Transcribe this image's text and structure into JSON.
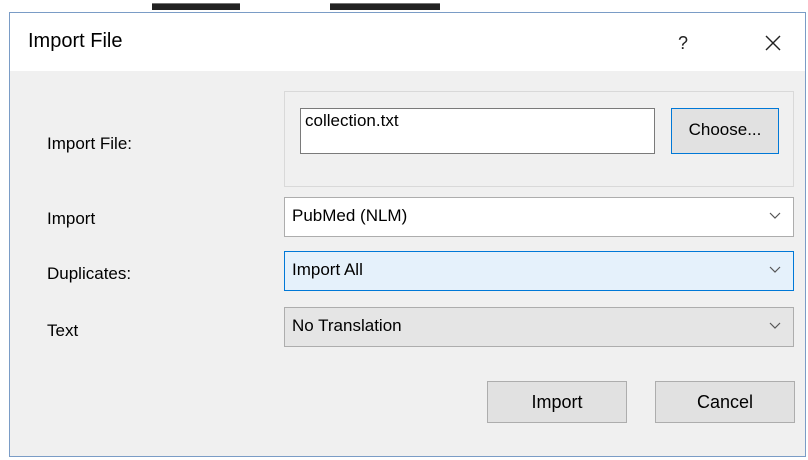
{
  "dialog": {
    "title": "Import File",
    "help_label": "?"
  },
  "fields": {
    "import_file": {
      "label": "Import File:",
      "value": "collection.txt",
      "choose_label": "Choose..."
    },
    "import_option": {
      "label": "Import",
      "selected": "PubMed (NLM)"
    },
    "duplicates": {
      "label": "Duplicates:",
      "selected": "Import All"
    },
    "text_translation": {
      "label": "Text",
      "selected": "No Translation"
    }
  },
  "buttons": {
    "import_label": "Import",
    "cancel_label": "Cancel"
  },
  "icons": {
    "close": "close-icon",
    "dropdown": "chevron-down-icon"
  },
  "colors": {
    "accent": "#0078d7",
    "focused_select_bg": "#e5f1fb",
    "client_bg": "#f0f0f0"
  }
}
